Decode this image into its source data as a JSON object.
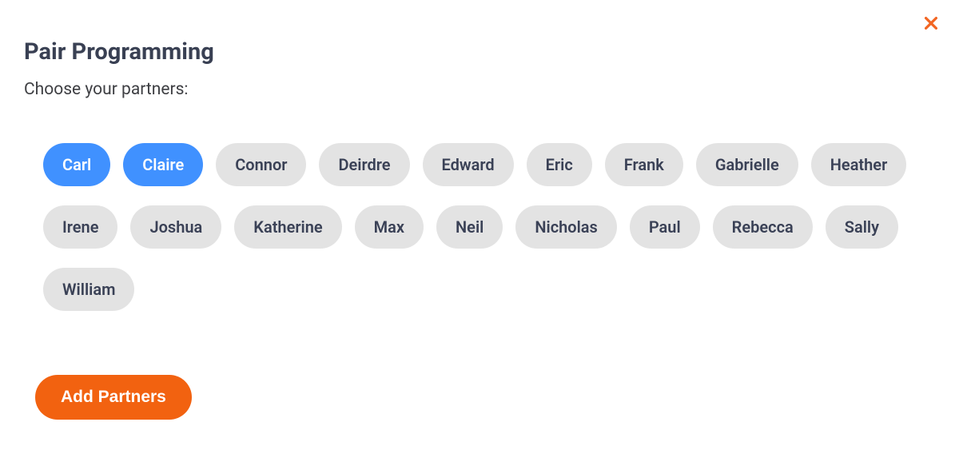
{
  "header": {
    "title": "Pair Programming",
    "subtitle": "Choose your partners:"
  },
  "partners": [
    {
      "name": "Carl",
      "selected": true
    },
    {
      "name": "Claire",
      "selected": true
    },
    {
      "name": "Connor",
      "selected": false
    },
    {
      "name": "Deirdre",
      "selected": false
    },
    {
      "name": "Edward",
      "selected": false
    },
    {
      "name": "Eric",
      "selected": false
    },
    {
      "name": "Frank",
      "selected": false
    },
    {
      "name": "Gabrielle",
      "selected": false
    },
    {
      "name": "Heather",
      "selected": false
    },
    {
      "name": "Irene",
      "selected": false
    },
    {
      "name": "Joshua",
      "selected": false
    },
    {
      "name": "Katherine",
      "selected": false
    },
    {
      "name": "Max",
      "selected": false
    },
    {
      "name": "Neil",
      "selected": false
    },
    {
      "name": "Nicholas",
      "selected": false
    },
    {
      "name": "Paul",
      "selected": false
    },
    {
      "name": "Rebecca",
      "selected": false
    },
    {
      "name": "Sally",
      "selected": false
    },
    {
      "name": "William",
      "selected": false
    }
  ],
  "actions": {
    "add_partners_label": "Add Partners"
  },
  "colors": {
    "accent_orange": "#F26210",
    "accent_blue": "#4091FF",
    "chip_bg": "#e3e3e3",
    "text_dark": "#394053"
  }
}
